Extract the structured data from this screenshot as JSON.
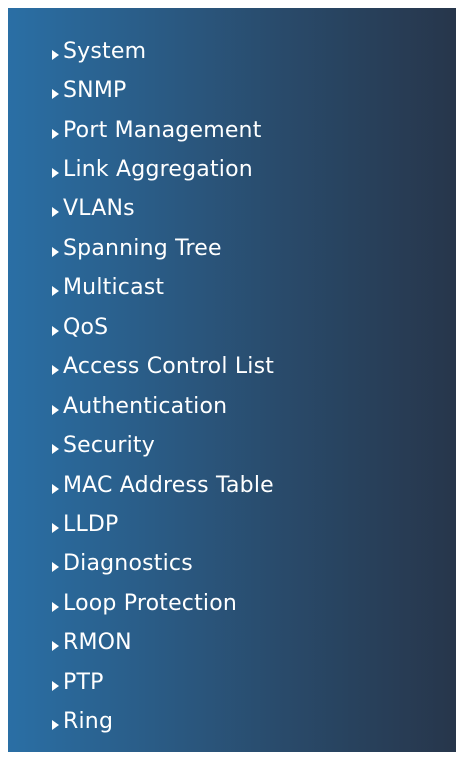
{
  "menu": {
    "items": [
      {
        "label": "System"
      },
      {
        "label": "SNMP"
      },
      {
        "label": "Port Management"
      },
      {
        "label": "Link Aggregation"
      },
      {
        "label": "VLANs"
      },
      {
        "label": "Spanning Tree"
      },
      {
        "label": "Multicast"
      },
      {
        "label": "QoS"
      },
      {
        "label": "Access Control List"
      },
      {
        "label": "Authentication"
      },
      {
        "label": "Security"
      },
      {
        "label": "MAC Address Table"
      },
      {
        "label": "LLDP"
      },
      {
        "label": "Diagnostics"
      },
      {
        "label": "Loop Protection"
      },
      {
        "label": "RMON"
      },
      {
        "label": "PTP"
      },
      {
        "label": "Ring"
      }
    ],
    "arrow_icon": "triangle-right-icon",
    "text_color": "#ffffff",
    "gradient_colors": [
      "#2a6fa5",
      "#27364b"
    ]
  }
}
